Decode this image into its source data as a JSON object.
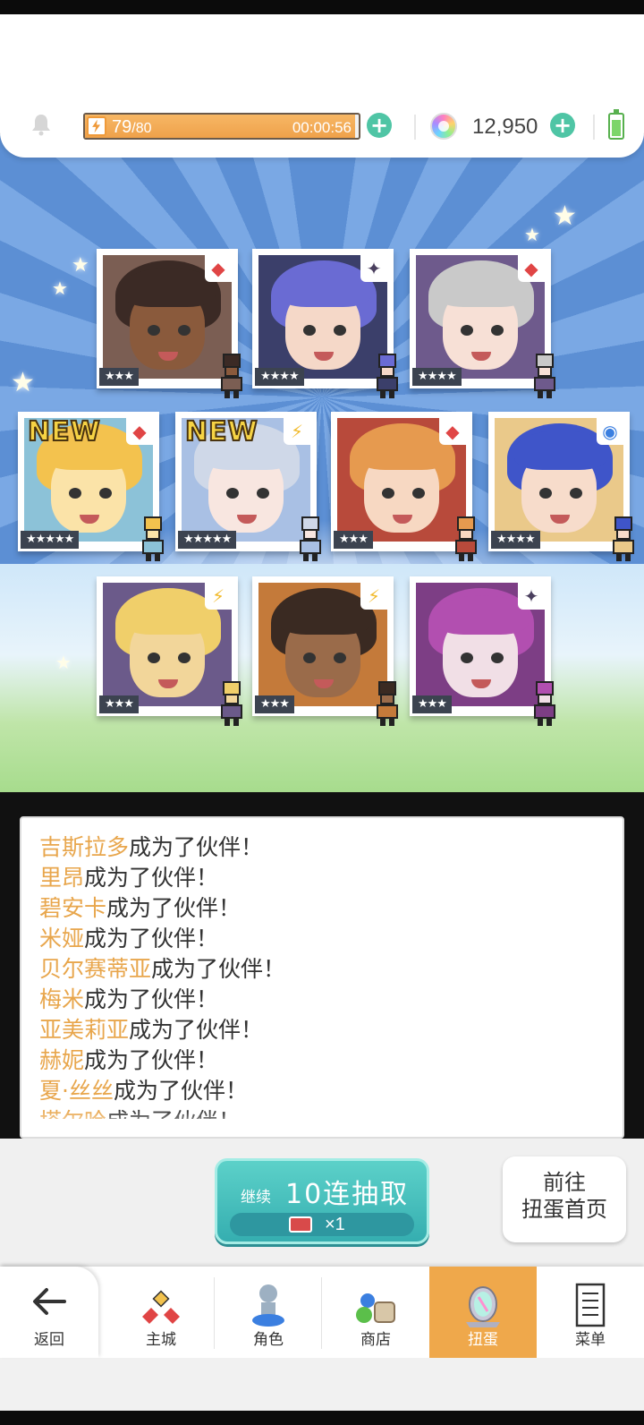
{
  "header": {
    "energy_current": "79",
    "energy_max": "/80",
    "energy_fraction": 0.9875,
    "energy_timer": "00:00:56",
    "gem_count": "12,950",
    "plus_label": "+"
  },
  "cards": [
    {
      "stars": "★★★",
      "element": "fire",
      "element_glyph": "◆",
      "element_color": "#e04545",
      "new": false,
      "new_label": "",
      "skin": "#8a5a3c",
      "hair": "#3b2a25",
      "bg": "#7b5e53"
    },
    {
      "stars": "★★★★",
      "element": "dark",
      "element_glyph": "✦",
      "element_color": "#4a3f5e",
      "new": false,
      "new_label": "",
      "skin": "#f5d8c8",
      "hair": "#6a6bd3",
      "bg": "#3b3f6a"
    },
    {
      "stars": "★★★★",
      "element": "fire",
      "element_glyph": "◆",
      "element_color": "#e04545",
      "new": false,
      "new_label": "",
      "skin": "#f7e0d6",
      "hair": "#c9c9c9",
      "bg": "#6e5a8c"
    },
    {
      "stars": "★★★★★",
      "element": "fire",
      "element_glyph": "◆",
      "element_color": "#e04545",
      "new": true,
      "new_label": "NEW",
      "skin": "#fbe3a8",
      "hair": "#f3c24e",
      "bg": "#8cc2d8"
    },
    {
      "stars": "★★★★★",
      "element": "thunder",
      "element_glyph": "⚡",
      "element_color": "#f2bb2e",
      "new": true,
      "new_label": "NEW",
      "skin": "#f8e6e0",
      "hair": "#cfd8e8",
      "bg": "#a9c0e4"
    },
    {
      "stars": "★★★",
      "element": "fire",
      "element_glyph": "◆",
      "element_color": "#e04545",
      "new": false,
      "new_label": "",
      "skin": "#f7d8c2",
      "hair": "#e69a4f",
      "bg": "#b84a3b"
    },
    {
      "stars": "★★★★",
      "element": "water",
      "element_glyph": "◉",
      "element_color": "#3b7fe0",
      "new": false,
      "new_label": "",
      "skin": "#f7dccb",
      "hair": "#3f55c9",
      "bg": "#eac98a"
    },
    {
      "stars": "★★★",
      "element": "thunder",
      "element_glyph": "⚡",
      "element_color": "#f2bb2e",
      "new": false,
      "new_label": "",
      "skin": "#f2d69a",
      "hair": "#f0cf6a",
      "bg": "#6b5a8a"
    },
    {
      "stars": "★★★",
      "element": "thunder",
      "element_glyph": "⚡",
      "element_color": "#f2bb2e",
      "new": false,
      "new_label": "",
      "skin": "#9a6b4a",
      "hair": "#3a2a22",
      "bg": "#c47a3a"
    },
    {
      "stars": "★★★",
      "element": "dark",
      "element_glyph": "✦",
      "element_color": "#4a3f5e",
      "new": false,
      "new_label": "",
      "skin": "#f1dfe6",
      "hair": "#b24fb0",
      "bg": "#7d3e85"
    }
  ],
  "log": {
    "suffix": "成为了伙伴！",
    "entries": [
      {
        "name": "吉斯拉多"
      },
      {
        "name": "里昂"
      },
      {
        "name": "碧安卡"
      },
      {
        "name": "米娅"
      },
      {
        "name": "贝尔赛蒂亚"
      },
      {
        "name": "梅米"
      },
      {
        "name": "亚美莉亚"
      },
      {
        "name": "赫妮"
      },
      {
        "name": "夏·丝丝"
      },
      {
        "name": "塔尔哈"
      }
    ]
  },
  "pull_button": {
    "continue_label": "继续",
    "main_label": "10连抽取",
    "cost_multiplier": "×1"
  },
  "goto_button": {
    "line1": "前往",
    "line2": "扭蛋首页"
  },
  "nav": {
    "back": "返回",
    "items": [
      "主城",
      "角色",
      "商店",
      "扭蛋",
      "菜单"
    ],
    "active_index": 3
  },
  "colors": {
    "accent_orange": "#efa84b",
    "accent_teal": "#4fc5a5",
    "name_highlight": "#e8a64c"
  }
}
